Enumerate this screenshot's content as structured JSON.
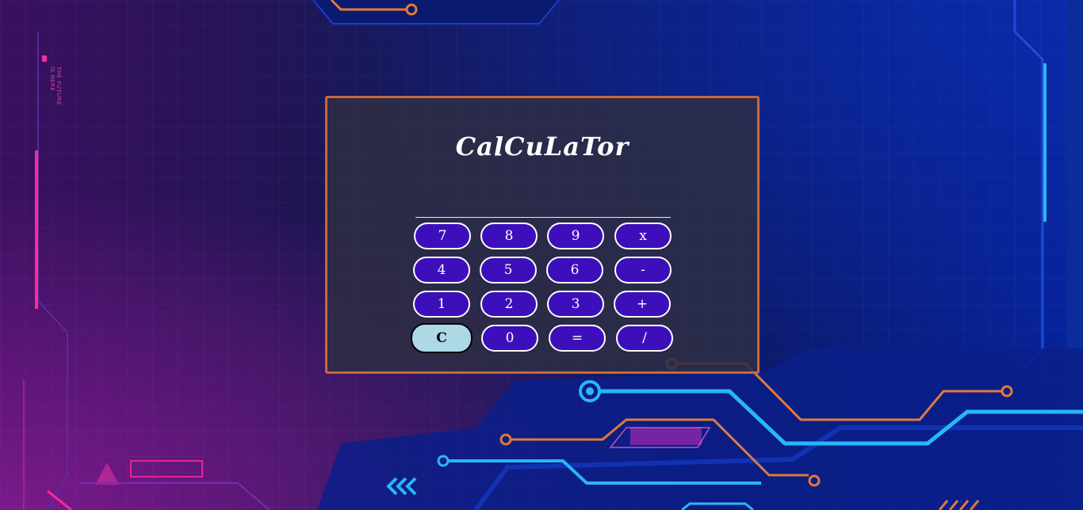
{
  "calculator": {
    "title": "CalCuLaTor",
    "display_value": "",
    "rows": [
      [
        "7",
        "8",
        "9",
        "x"
      ],
      [
        "4",
        "5",
        "6",
        "-"
      ],
      [
        "1",
        "2",
        "3",
        "+"
      ],
      [
        "C",
        "0",
        "=",
        "/"
      ]
    ]
  },
  "background": {
    "side_text_1": "THE FUTURE",
    "side_text_2": "IS HERE",
    "accent_colors": {
      "frame": "#c8683a",
      "key_fill": "#3d0fbb",
      "clear_key_fill": "#add8e6",
      "circuit_cyan": "#29b6f6",
      "circuit_orange": "#e07a3a",
      "circuit_pink": "#ff2a9a"
    }
  }
}
